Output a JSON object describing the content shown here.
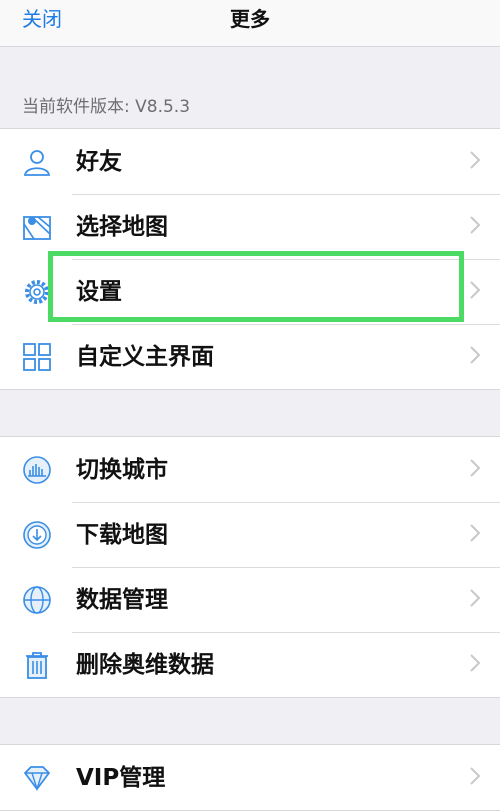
{
  "navbar": {
    "close_label": "关闭",
    "title": "更多"
  },
  "version_text": "当前软件版本: V8.5.3",
  "group1": [
    {
      "label": "好友",
      "icon": "user-icon"
    },
    {
      "label": "选择地图",
      "icon": "map-icon"
    },
    {
      "label": "设置",
      "icon": "gear-icon"
    },
    {
      "label": "自定义主界面",
      "icon": "grid-icon"
    }
  ],
  "group2": [
    {
      "label": "切换城市",
      "icon": "city-icon"
    },
    {
      "label": "下载地图",
      "icon": "download-icon"
    },
    {
      "label": "数据管理",
      "icon": "globe-icon"
    },
    {
      "label": "删除奥维数据",
      "icon": "trash-icon"
    }
  ],
  "group3": [
    {
      "label": "VIP管理",
      "icon": "diamond-icon"
    }
  ],
  "colors": {
    "accent": "#1e7be3",
    "highlight": "#4cd964",
    "icon": "#3a8ee6"
  }
}
